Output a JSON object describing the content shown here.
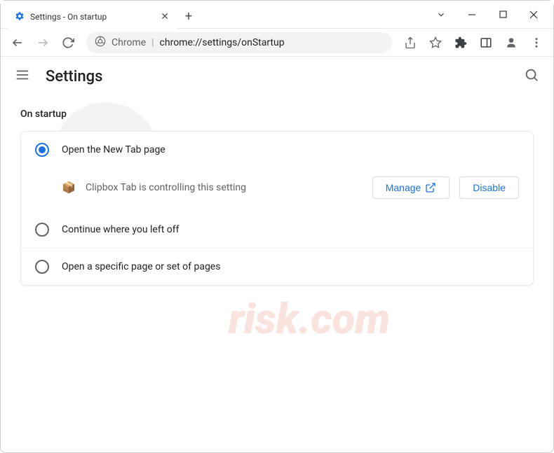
{
  "window": {
    "tab_title": "Settings - On startup"
  },
  "omnibox": {
    "scheme_label": "Chrome",
    "url_display": "chrome://settings/onStartup"
  },
  "header": {
    "title": "Settings"
  },
  "section": {
    "title": "On startup",
    "options": [
      {
        "label": "Open the New Tab page",
        "selected": true
      },
      {
        "label": "Continue where you left off",
        "selected": false
      },
      {
        "label": "Open a specific page or set of pages",
        "selected": false
      }
    ],
    "controlled_by": {
      "text": "Clipbox Tab is controlling this setting",
      "manage_label": "Manage",
      "disable_label": "Disable"
    }
  }
}
